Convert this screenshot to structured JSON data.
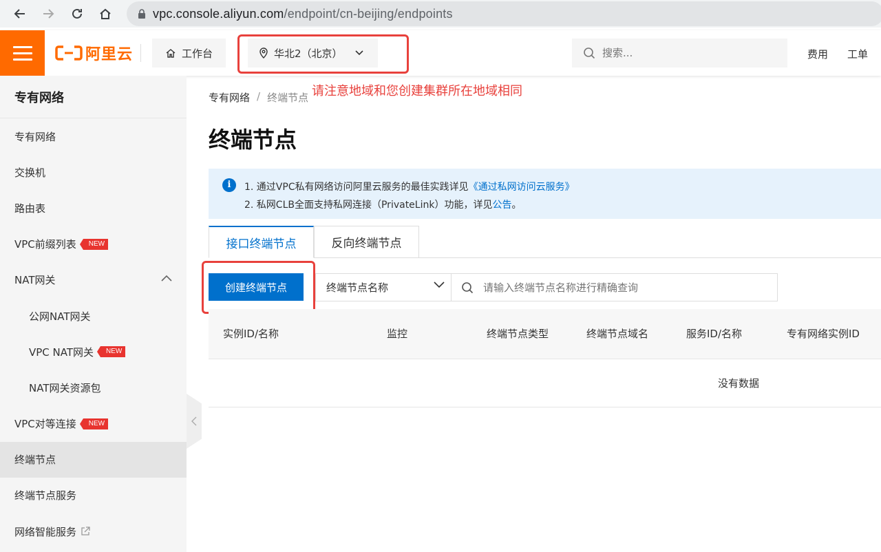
{
  "browser": {
    "url_host": "vpc.console.aliyun.com",
    "url_path": "/endpoint/cn-beijing/endpoints"
  },
  "header": {
    "logo_text": "阿里云",
    "workbench_label": "工作台",
    "region_label": "华北2（北京）",
    "search_placeholder": "搜索...",
    "links": [
      "费用",
      "工单"
    ],
    "accent_color": "#ff6a00"
  },
  "annotation": {
    "text": "请注意地域和您创建集群所在地域相同",
    "color": "#e8413c"
  },
  "sidebar": {
    "title": "专有网络",
    "items": [
      {
        "label": "专有网络"
      },
      {
        "label": "交换机"
      },
      {
        "label": "路由表"
      },
      {
        "label": "VPC前缀列表",
        "badge": "NEW"
      },
      {
        "label": "NAT网关"
      },
      {
        "label": "公网NAT网关"
      },
      {
        "label": "VPC NAT网关",
        "badge": "NEW"
      },
      {
        "label": "NAT网关资源包"
      },
      {
        "label": "VPC对等连接",
        "badge": "NEW"
      },
      {
        "label": "终端节点"
      },
      {
        "label": "终端节点服务"
      },
      {
        "label": "网络智能服务"
      }
    ]
  },
  "breadcrumb": {
    "root": "专有网络",
    "separator": "/",
    "current": "终端节点"
  },
  "page": {
    "title": "终端节点"
  },
  "notice": {
    "line1_prefix": "1. 通过VPC私有网络访问阿里云服务的最佳实践详见",
    "line1_link": "《通过私网访问云服务》",
    "line2_prefix": "2. 私网CLB全面支持私网连接（PrivateLink）功能，详见",
    "line2_link": "公告",
    "line2_suffix": "。"
  },
  "tabs": [
    {
      "label": "接口终端节点",
      "active": true
    },
    {
      "label": "反向终端节点",
      "active": false
    }
  ],
  "toolbar": {
    "create_label": "创建终端节点",
    "filter_select": "终端节点名称",
    "filter_placeholder": "请输入终端节点名称进行精确查询"
  },
  "table": {
    "columns": [
      "实例ID/名称",
      "监控",
      "终端节点类型",
      "终端节点域名",
      "服务ID/名称",
      "专有网络实例ID"
    ],
    "empty_text": "没有数据"
  }
}
